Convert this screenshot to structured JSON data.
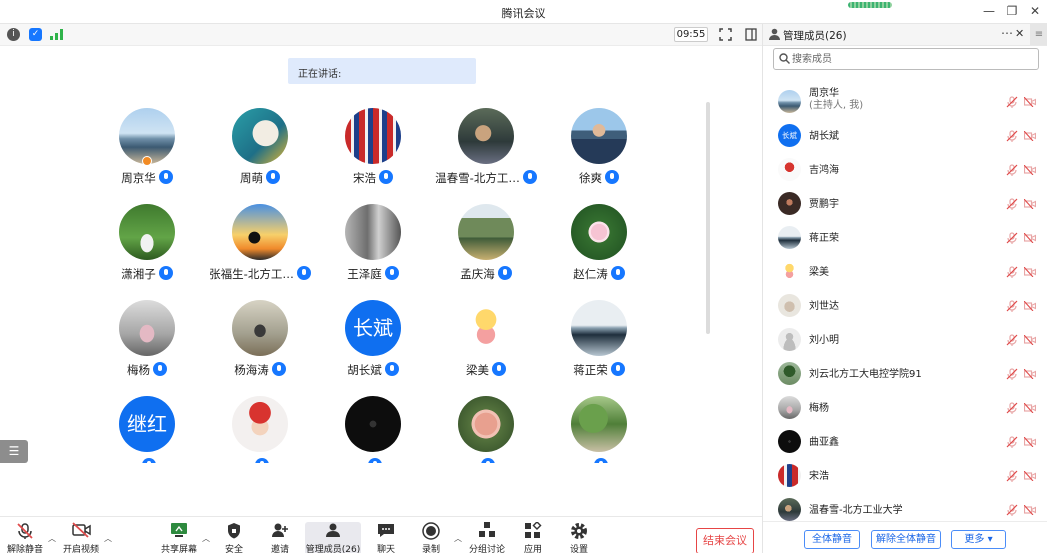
{
  "window": {
    "title": "腾讯会议"
  },
  "video_toolbar": {
    "timer": "09:55"
  },
  "speaking": {
    "label": "正在讲话:"
  },
  "gallery": {
    "tiles": [
      {
        "name": "周京华",
        "avatar": "photo-sea"
      },
      {
        "name": "周萌",
        "avatar": "photo-teal-art"
      },
      {
        "name": "宋浩",
        "avatar": "photo-flag"
      },
      {
        "name": "温春雪-北方工…",
        "avatar": "photo-wheelchair"
      },
      {
        "name": "徐爽",
        "avatar": "photo-man-lake"
      },
      {
        "name": "潇湘子",
        "avatar": "photo-girl-trees"
      },
      {
        "name": "张福生-北方工…",
        "avatar": "photo-sunset"
      },
      {
        "name": "王泽庭",
        "avatar": "photo-grey-indoor"
      },
      {
        "name": "孟庆海",
        "avatar": "photo-mountain"
      },
      {
        "name": "赵仁涛",
        "avatar": "photo-lotus"
      },
      {
        "name": "梅杨",
        "avatar": "photo-woman-sitting"
      },
      {
        "name": "杨海涛",
        "avatar": "photo-man-standing"
      },
      {
        "name": "胡长斌",
        "avatar_text": "长斌"
      },
      {
        "name": "梁美",
        "avatar": "cartoon-kid"
      },
      {
        "name": "蒋正荣",
        "avatar": "photo-misty-lake"
      },
      {
        "name": "",
        "avatar_text": "继红"
      },
      {
        "name": "",
        "avatar": "cartoon-girl-red"
      },
      {
        "name": "",
        "avatar": "photo-black"
      },
      {
        "name": "",
        "avatar": "photo-pink-flower"
      },
      {
        "name": "",
        "avatar": "photo-green-trees"
      }
    ]
  },
  "toolbar": {
    "unmute": "解除静音",
    "start_video": "开启视频",
    "share": "共享屏幕",
    "security": "安全",
    "invite": "邀请",
    "members": "管理成员(26)",
    "chat": "聊天",
    "record": "录制",
    "breakout": "分组讨论",
    "apps": "应用",
    "settings": "设置",
    "end": "结束会议"
  },
  "panel": {
    "title": "管理成员(26)",
    "search_placeholder": "搜索成员",
    "members": [
      {
        "name": "周京华",
        "sub": "(主持人, 我)",
        "avatar": "photo-sea"
      },
      {
        "name": "胡长斌",
        "avatar_text": "长斌"
      },
      {
        "name": "吉鸿海",
        "avatar": "cartoon-red"
      },
      {
        "name": "贾鹏宇",
        "avatar": "photo-dark"
      },
      {
        "name": "蒋正荣",
        "avatar": "photo-misty-lake"
      },
      {
        "name": "梁美",
        "avatar": "cartoon-kid"
      },
      {
        "name": "刘世达",
        "avatar": "photo-cat"
      },
      {
        "name": "刘小明",
        "avatar": "default-user"
      },
      {
        "name": "刘云北方工大电控学院91",
        "avatar": "photo-tree"
      },
      {
        "name": "梅杨",
        "avatar": "photo-woman-sitting"
      },
      {
        "name": "曲亚鑫",
        "avatar": "photo-black"
      },
      {
        "name": "宋浩",
        "avatar": "photo-flag"
      },
      {
        "name": "温春雪-北方工业大学",
        "avatar": "photo-wheelchair"
      }
    ],
    "mute_all": "全体静音",
    "unmute_all": "解除全体静音",
    "more": "更多 ▾"
  },
  "colors": {
    "accent": "#1677ff",
    "danger": "#e64545",
    "muted_icon": "#e04b4b"
  }
}
